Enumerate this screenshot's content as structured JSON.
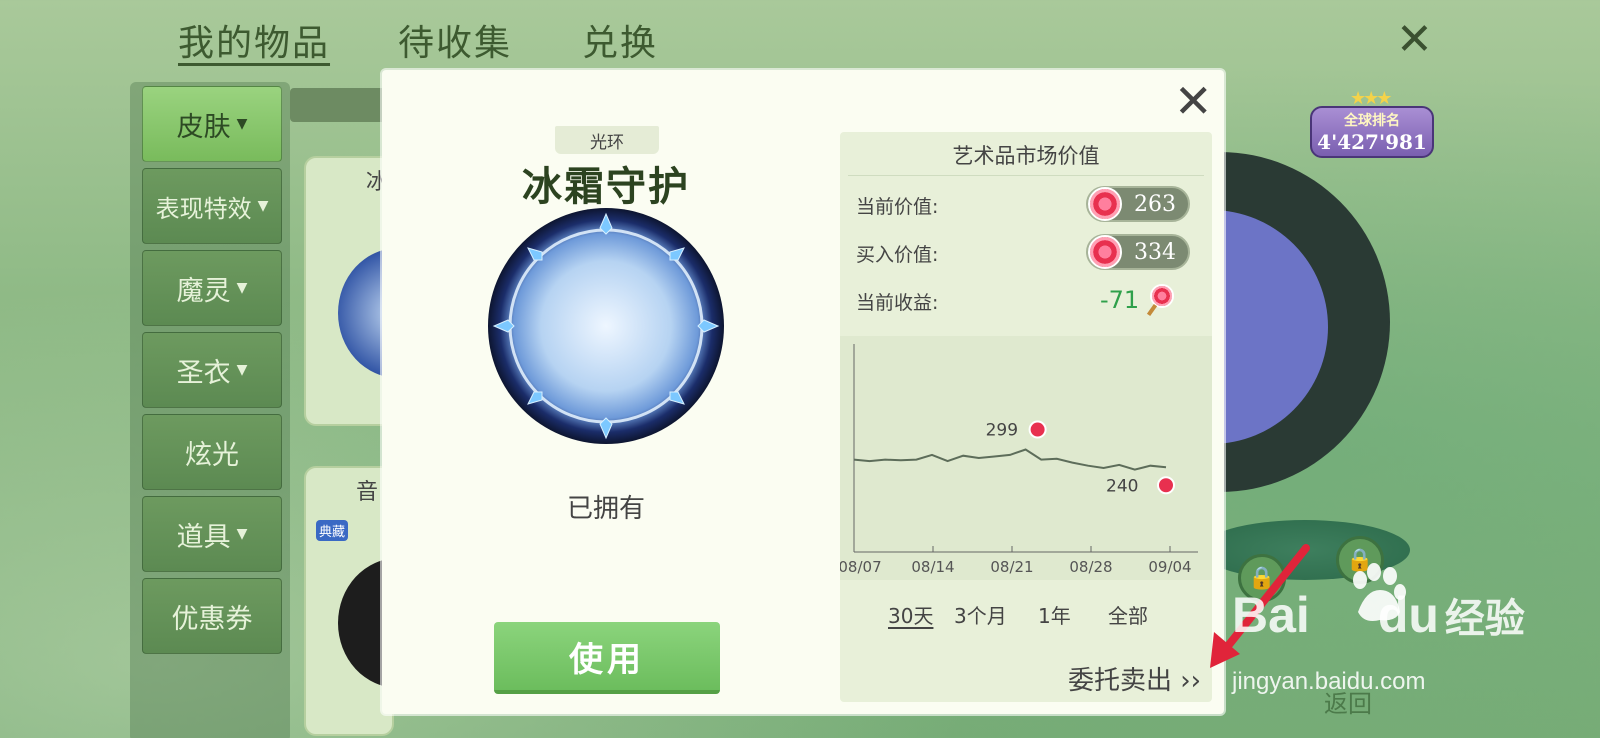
{
  "top_tabs": [
    "我的物品",
    "待收集",
    "兑换"
  ],
  "sidebar": [
    {
      "label": "皮肤",
      "caret": true
    },
    {
      "label": "表现特效",
      "caret": true
    },
    {
      "label": "魔灵",
      "caret": true
    },
    {
      "label": "圣衣",
      "caret": true
    },
    {
      "label": "炫光",
      "caret": false
    },
    {
      "label": "道具",
      "caret": true
    },
    {
      "label": "优惠券",
      "caret": false
    }
  ],
  "background": {
    "rank_badge": {
      "title": "全球排名",
      "value": "4'427'981"
    },
    "return_label": "返回",
    "card_labels": [
      "冰",
      "音",
      "典藏"
    ]
  },
  "modal": {
    "item_type": "光环",
    "item_name": "冰霜守护",
    "status": "已拥有",
    "use_button": "使用"
  },
  "market": {
    "title": "艺术品市场价值",
    "current_value_label": "当前价值:",
    "current_value": "263",
    "buy_value_label": "买入价值:",
    "buy_value": "334",
    "profit_label": "当前收益:",
    "profit": "-71",
    "range_tabs": [
      "30天",
      "3个月",
      "1年",
      "全部"
    ],
    "sell_link": "委托卖出",
    "sell_arrow": "››"
  },
  "chart_data": {
    "type": "line",
    "x_ticks": [
      "08/07",
      "08/14",
      "08/21",
      "08/28",
      "09/04"
    ],
    "series": [
      {
        "values": [
          270,
          268,
          270,
          269,
          270,
          276,
          268,
          275,
          272,
          274,
          276,
          283,
          270,
          271,
          266,
          262,
          259,
          263,
          257,
          262,
          260
        ]
      }
    ],
    "max_label": "299",
    "last_label": "240",
    "ylim": [
      150,
      420
    ]
  },
  "watermark": {
    "brand": "Bai",
    "brand2": "du",
    "brand3": "经验",
    "url": "jingyan.baidu.com"
  },
  "colors": {
    "accent_green": "#79bb5c",
    "profit_green": "#2fa04b",
    "candy_red": "#e8304f"
  }
}
